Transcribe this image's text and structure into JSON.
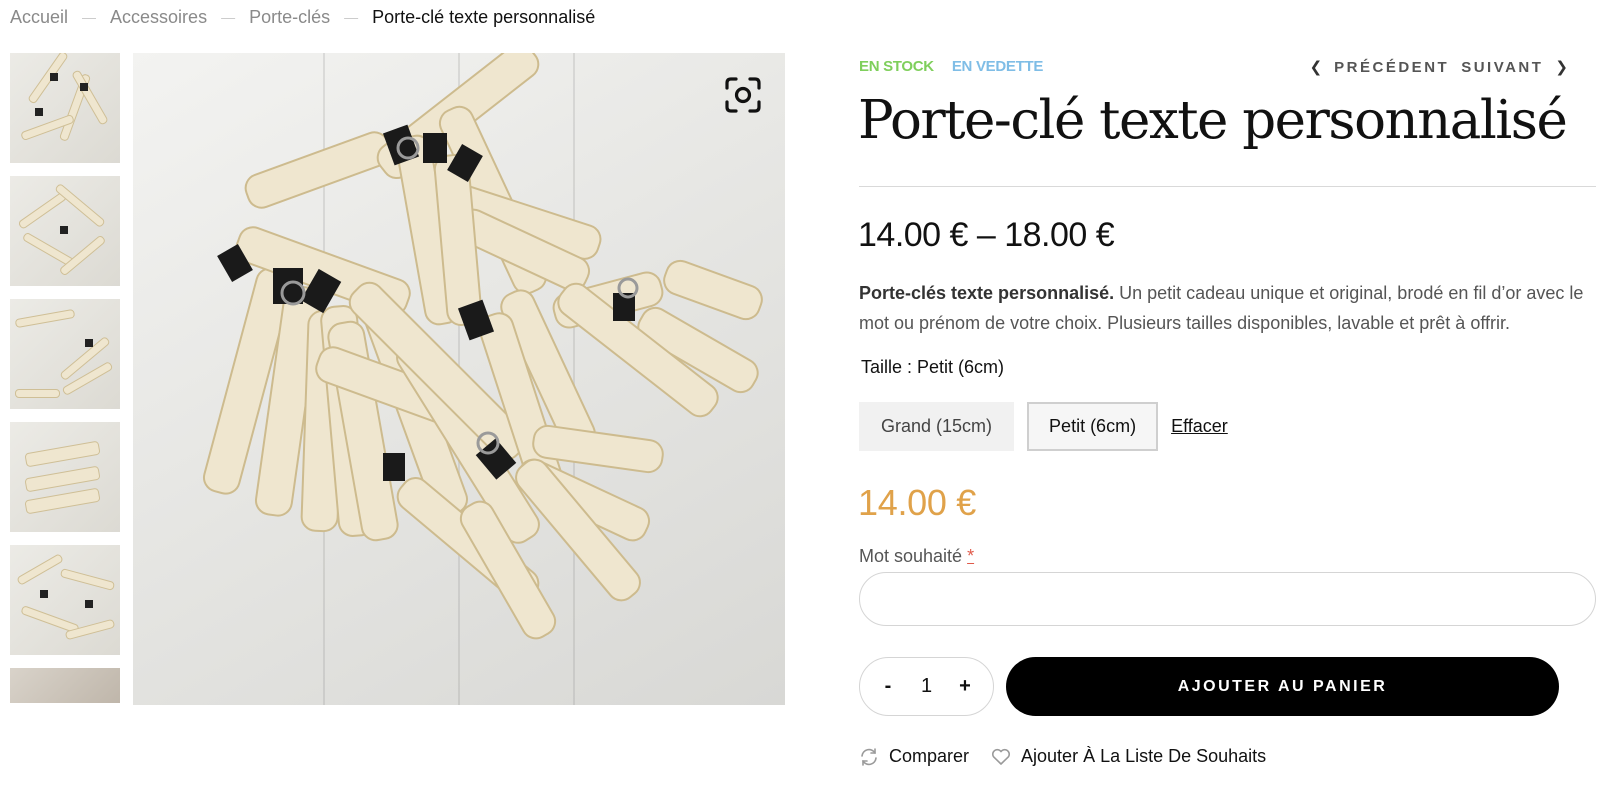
{
  "breadcrumb": {
    "items": [
      "Accueil",
      "Accessoires",
      "Porte-clés",
      "Porte-clé texte personnalisé"
    ],
    "separator": "—"
  },
  "gallery": {
    "thumbnail_count": 6,
    "zoom_icon": "zoom-scan-icon"
  },
  "badges": {
    "stock": "EN STOCK",
    "featured": "EN VEDETTE"
  },
  "nav": {
    "previous": "PRÉCÉDENT",
    "next": "SUIVANT"
  },
  "product": {
    "title": "Porte-clé texte personnalisé",
    "price_range": "14.00 € – 18.00 €",
    "description_bold": "Porte-clés texte personnalisé.",
    "description_rest": " Un petit cadeau unique et original, brodé en fil d’or avec le mot ou prénom de votre choix. Plusieurs tailles disponibles, lavable et prêt à offrir.",
    "current_price": "14.00 €"
  },
  "variation": {
    "label": "Taille : Petit (6cm)",
    "options": [
      "Grand (15cm)",
      "Petit (6cm)"
    ],
    "selected": "Petit (6cm)",
    "clear": "Effacer"
  },
  "custom_field": {
    "label": "Mot souhaité",
    "required_mark": "*",
    "value": ""
  },
  "cart": {
    "minus": "-",
    "quantity": "1",
    "plus": "+",
    "add_to_cart": "AJOUTER AU PANIER"
  },
  "actions": {
    "compare": "Comparer",
    "wishlist": "Ajouter À La Liste De Souhaits"
  },
  "colors": {
    "in_stock": "#7fcf5c",
    "featured": "#7fbde6",
    "price_accent": "#e0a24a",
    "button": "#000000"
  }
}
